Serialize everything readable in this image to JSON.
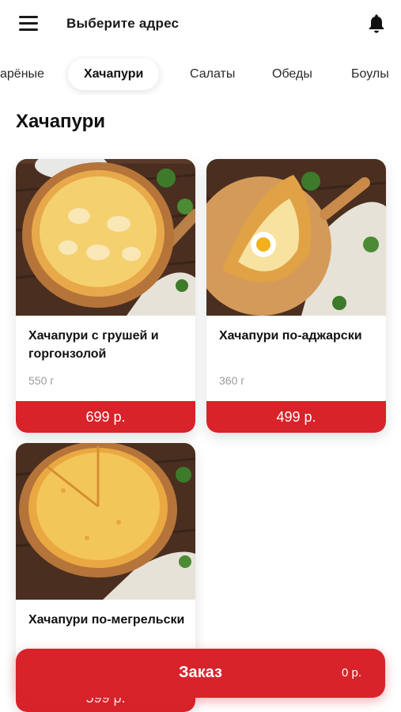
{
  "header": {
    "address_label": "Выберите адрес",
    "menu_icon": "hamburger-menu-icon",
    "notification_icon": "bell-icon"
  },
  "categories": [
    {
      "label": "арёные"
    },
    {
      "label": "Хачапури",
      "active": true
    },
    {
      "label": "Салаты"
    },
    {
      "label": "Обеды"
    },
    {
      "label": "Боулы"
    }
  ],
  "section": {
    "title": "Хачапури"
  },
  "products": [
    {
      "name": "Хачапури с грушей и горгонзолой",
      "weight": "550 г",
      "price": "699 р."
    },
    {
      "name": "Хачапури по-аджарски",
      "weight": "360 г",
      "price": "499 р."
    },
    {
      "name": "Хачапури по-мегрельски",
      "weight": "",
      "price": "599 р."
    }
  ],
  "order": {
    "label": "Заказ",
    "total": "0 р."
  },
  "colors": {
    "accent": "#d8232a",
    "wood": "#c98a4a",
    "cheese": "#f2c35a"
  }
}
